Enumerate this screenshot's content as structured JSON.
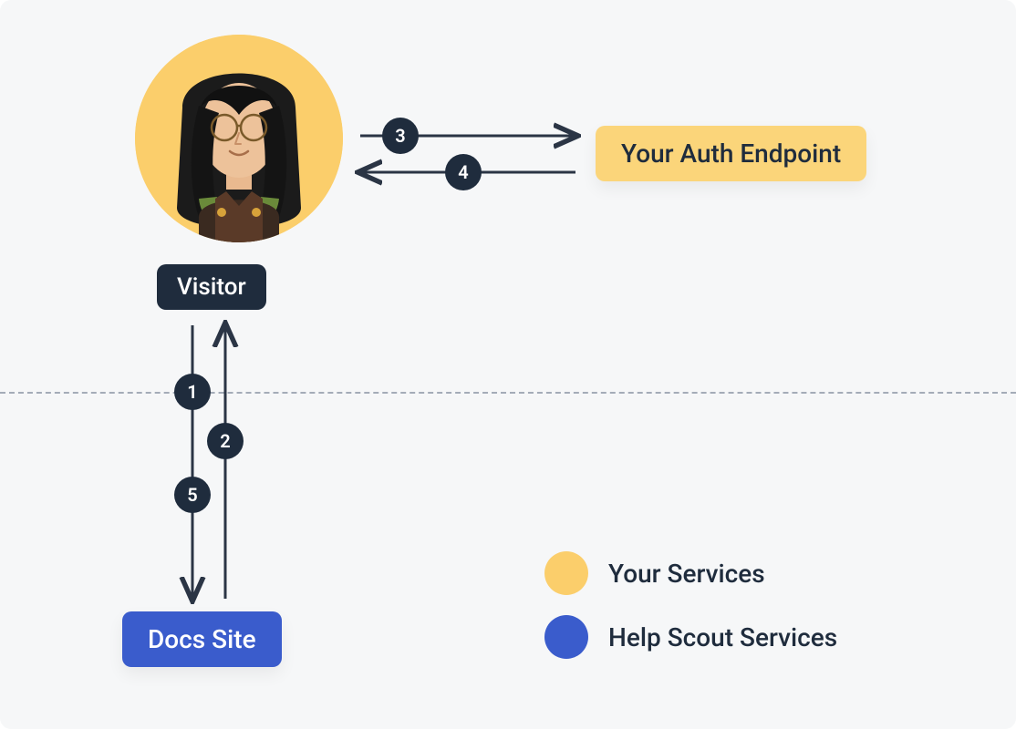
{
  "nodes": {
    "visitor_label": "Visitor",
    "auth_endpoint_label": "Your Auth Endpoint",
    "docs_site_label": "Docs Site"
  },
  "steps": {
    "s1": "1",
    "s2": "2",
    "s3": "3",
    "s4": "4",
    "s5": "5"
  },
  "legend": {
    "your_services": "Your Services",
    "help_scout_services": "Help Scout Services"
  },
  "colors": {
    "dark": "#1f2c3d",
    "yellow": "#fbd57a",
    "avatar_bg": "#fbce6b",
    "blue": "#3a5ccc",
    "arrow": "#2b3545",
    "divider": "#a4acb8"
  }
}
